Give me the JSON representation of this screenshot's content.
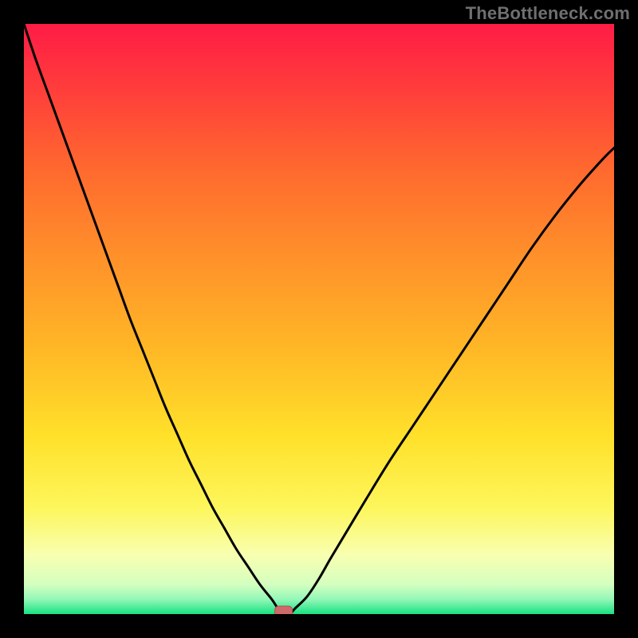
{
  "watermark": "TheBottleneck.com",
  "colors": {
    "frame": "#000000",
    "curve": "#000000",
    "marker_fill": "#cf6a6a",
    "marker_stroke": "#b24e50",
    "gradient_stops": [
      {
        "offset": 0.0,
        "color": "#ff1c46"
      },
      {
        "offset": 0.1,
        "color": "#ff3a3c"
      },
      {
        "offset": 0.25,
        "color": "#ff6a2e"
      },
      {
        "offset": 0.4,
        "color": "#ff922a"
      },
      {
        "offset": 0.55,
        "color": "#ffb726"
      },
      {
        "offset": 0.7,
        "color": "#ffe12a"
      },
      {
        "offset": 0.82,
        "color": "#fdf65c"
      },
      {
        "offset": 0.9,
        "color": "#f8ffb0"
      },
      {
        "offset": 0.95,
        "color": "#d4ffc0"
      },
      {
        "offset": 0.975,
        "color": "#93f7b8"
      },
      {
        "offset": 1.0,
        "color": "#18e281"
      }
    ]
  },
  "chart_data": {
    "type": "line",
    "title": "",
    "xlabel": "",
    "ylabel": "",
    "xlim": [
      0,
      100
    ],
    "ylim": [
      0,
      100
    ],
    "marker": {
      "x": 44,
      "y": 0
    },
    "series": [
      {
        "name": "bottleneck-curve",
        "x": [
          0,
          2,
          4,
          6,
          8,
          10,
          12,
          14,
          16,
          18,
          20,
          22,
          24,
          26,
          28,
          30,
          32,
          34,
          36,
          38,
          40,
          42,
          43,
          44,
          45,
          46,
          48,
          50,
          52,
          55,
          58,
          62,
          66,
          70,
          74,
          78,
          82,
          86,
          90,
          94,
          98,
          100
        ],
        "y": [
          100,
          94,
          88.5,
          83,
          77.5,
          72,
          66.5,
          61,
          55.5,
          50,
          45,
          40,
          35,
          30.5,
          26,
          22,
          18,
          14.5,
          11,
          8,
          5,
          2.5,
          1,
          0,
          0,
          1,
          3,
          6,
          9.5,
          14.5,
          19.5,
          26,
          32,
          38,
          44,
          50,
          56,
          62,
          67.5,
          72.5,
          77,
          79
        ]
      }
    ]
  }
}
